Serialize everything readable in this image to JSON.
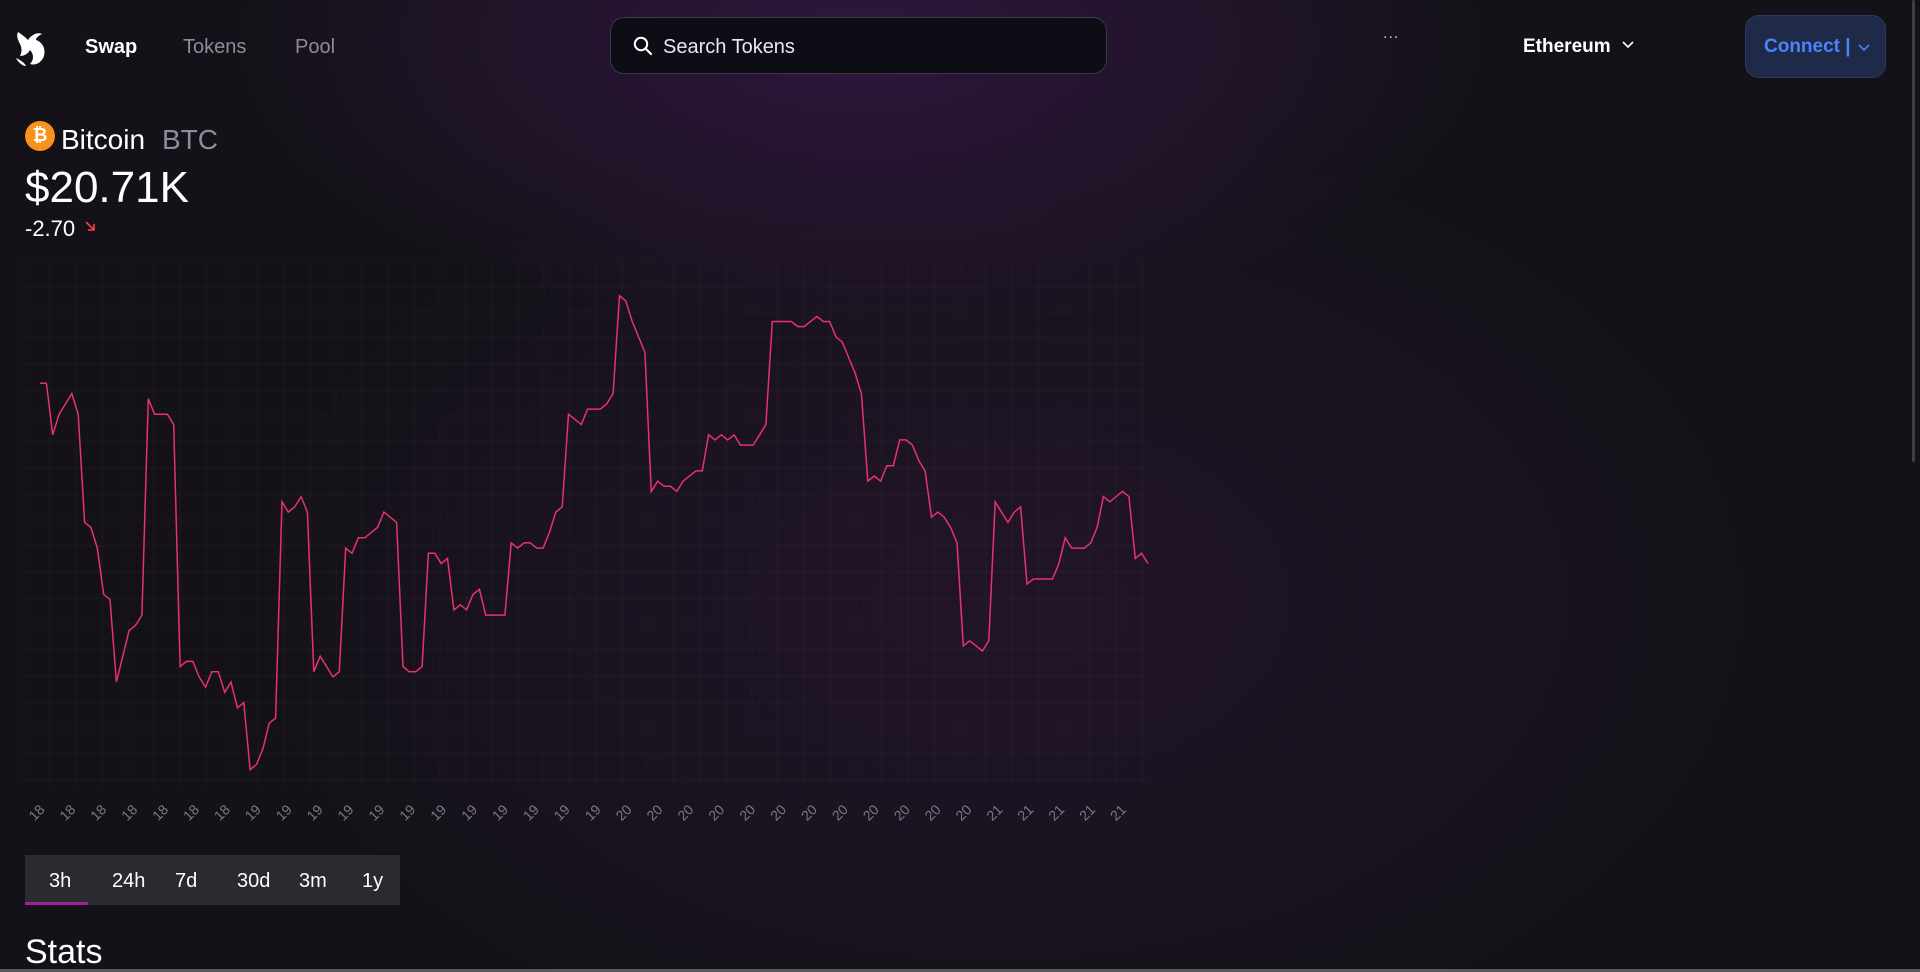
{
  "nav": {
    "logo_icon": "uniswap-unicorn-icon",
    "links": [
      {
        "label": "Swap",
        "active": true
      },
      {
        "label": "Tokens",
        "active": false
      },
      {
        "label": "Pool",
        "active": false
      }
    ],
    "search_placeholder": "Search Tokens",
    "more_label": "···",
    "network_label": "Ethereum",
    "connect_label": "Connect |"
  },
  "token": {
    "name": "Bitcoin",
    "symbol": "BTC",
    "icon_letter": "₿",
    "icon_color": "#f7931a",
    "price": "$20.71K",
    "change": "-2.70",
    "change_color": "#fd4040"
  },
  "time_tabs": [
    "3h",
    "24h",
    "7d",
    "30d",
    "3m",
    "1y"
  ],
  "selected_tab": "3h",
  "stats_heading": "Stats",
  "colors": {
    "line": "#e8316f",
    "accent": "#a01f9f",
    "connect_text": "#4c82fb",
    "connect_bg": "#1f2a48"
  },
  "chart_data": {
    "type": "line",
    "grid": true,
    "x_tick_labels": [
      "18",
      "18",
      "18",
      "18",
      "18",
      "18",
      "18",
      "19",
      "19",
      "19",
      "19",
      "19",
      "19",
      "19",
      "19",
      "19",
      "19",
      "19",
      "19",
      "20",
      "20",
      "20",
      "20",
      "20",
      "20",
      "20",
      "20",
      "20",
      "20",
      "20",
      "20",
      "21",
      "21",
      "21",
      "21",
      "21"
    ],
    "ylim": [
      0,
      100
    ],
    "values": [
      78,
      78,
      68,
      72,
      74,
      76,
      72,
      51,
      50,
      46,
      37,
      36,
      20,
      25,
      30,
      31,
      33,
      75,
      72,
      72,
      72,
      70,
      23,
      24,
      24,
      21,
      19,
      22,
      22,
      18,
      20,
      15,
      16,
      3,
      4,
      7,
      12,
      13,
      55,
      53,
      54,
      56,
      53,
      22,
      25,
      23,
      21,
      22,
      46,
      45,
      48,
      48,
      49,
      50,
      53,
      52,
      51,
      23,
      22,
      22,
      23,
      45,
      45,
      43,
      44,
      34,
      35,
      34,
      37,
      38,
      33,
      33,
      33,
      33,
      47,
      46,
      47,
      47,
      46,
      46,
      49,
      53,
      54,
      72,
      71,
      70,
      73,
      73,
      73,
      74,
      76,
      95,
      94,
      90,
      87,
      84,
      57,
      59,
      58,
      58,
      57,
      59,
      60,
      61,
      61,
      68,
      67,
      68,
      67,
      68,
      66,
      66,
      66,
      68,
      70,
      90,
      90,
      90,
      90,
      89,
      89,
      90,
      91,
      90,
      90,
      87,
      86,
      83,
      80,
      76,
      59,
      60,
      59,
      62,
      62,
      67,
      67,
      66,
      63,
      61,
      52,
      53,
      52,
      50,
      47,
      27,
      28,
      27,
      26,
      28,
      55,
      53,
      51,
      53,
      54,
      39,
      40,
      40,
      40,
      40,
      43,
      48,
      46,
      46,
      46,
      47,
      50,
      56,
      55,
      56,
      57,
      56,
      44,
      45,
      43
    ],
    "xlabel": "",
    "ylabel": ""
  }
}
